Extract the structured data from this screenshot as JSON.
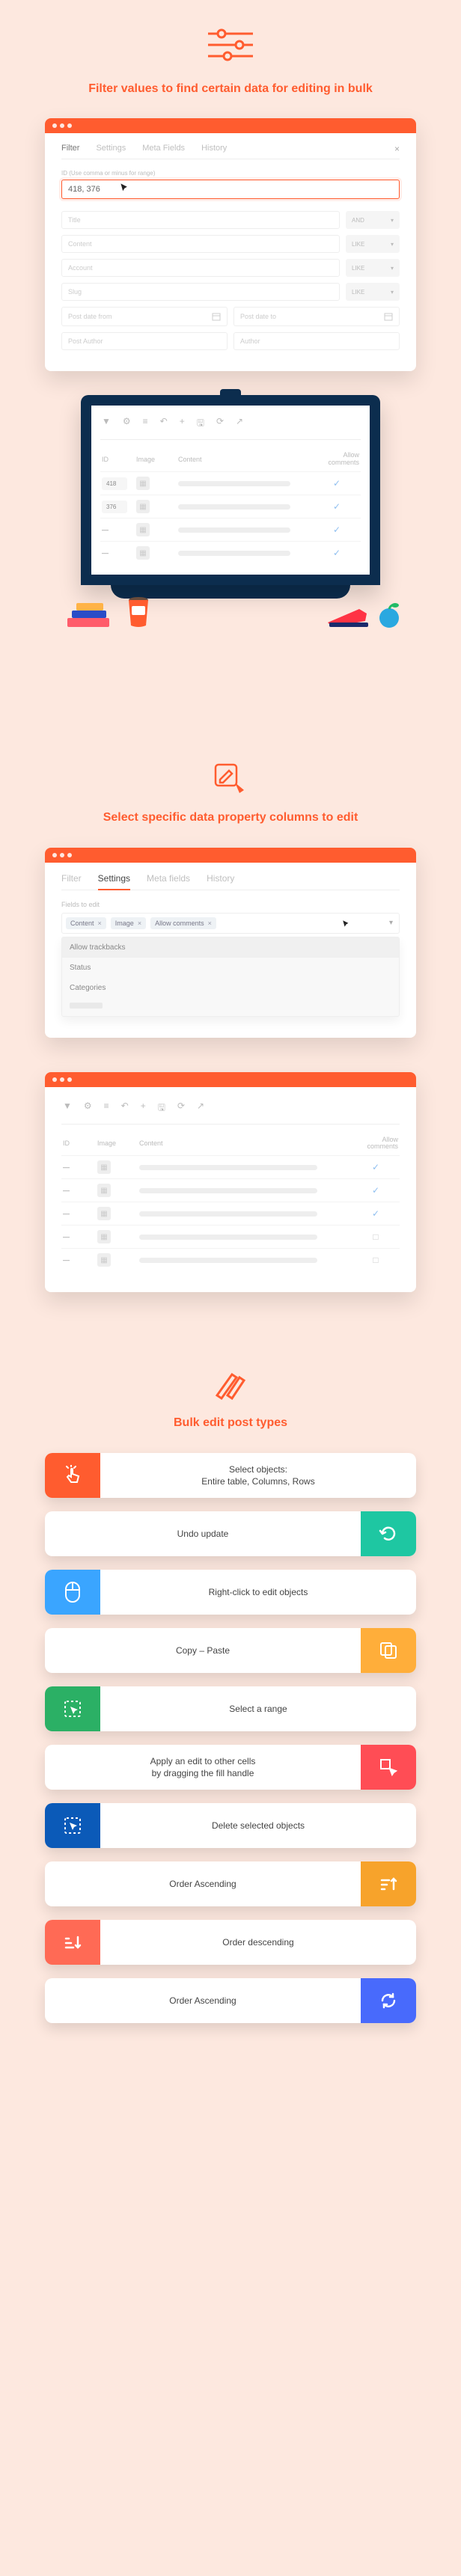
{
  "section1": {
    "title": "Filter values to find certain data for editing in bulk",
    "tabs": {
      "filter": "Filter",
      "settings": "Settings",
      "meta": "Meta Fields",
      "history": "History"
    },
    "id_hint": "ID (Use comma or minus for range)",
    "id_value": "418, 376",
    "filter_rows": {
      "title": "Title",
      "content": "Content",
      "account": "Account",
      "slug": "Slug",
      "date_from": "Post date from",
      "date_to": "Post date to",
      "author": "Post Author",
      "author_ph": "Author"
    },
    "select_and": "AND",
    "select_like": "LIKE"
  },
  "monitor": {
    "toolbar_icons": [
      "filter",
      "gear",
      "list",
      "undo",
      "plus",
      "save",
      "refresh",
      "open"
    ],
    "headers": {
      "id": "ID",
      "image": "Image",
      "content": "Content",
      "allow": "Allow comments"
    },
    "rows": [
      {
        "id": "418",
        "checked": true
      },
      {
        "id": "376",
        "checked": true
      },
      {
        "id": "",
        "checked": true
      },
      {
        "id": "",
        "checked": true
      }
    ]
  },
  "section2": {
    "title": "Select specific data property columns to edit",
    "tabs": {
      "filter": "Filter",
      "settings": "Settings",
      "meta": "Meta fields",
      "history": "History"
    },
    "fields_label": "Fields to edit",
    "chips": [
      "Content",
      "Image",
      "Allow comments"
    ],
    "dropdown": [
      "Allow trackbacks",
      "Status",
      "Categories"
    ]
  },
  "section3": {
    "title": "Bulk edit post types",
    "features": [
      {
        "side": "left",
        "color": "clr-orange",
        "icon": "tap",
        "line1": "Select objects:",
        "line2": "Entire table, Columns, Rows"
      },
      {
        "side": "right",
        "color": "clr-teal",
        "icon": "undo",
        "line1": "Undo update"
      },
      {
        "side": "left",
        "color": "clr-blue",
        "icon": "mouse",
        "line1": "Right-click to edit objects"
      },
      {
        "side": "right",
        "color": "clr-amber",
        "icon": "copy",
        "line1": "Copy – Paste"
      },
      {
        "side": "left",
        "color": "clr-green",
        "icon": "select",
        "line1": "Select a range"
      },
      {
        "side": "right",
        "color": "clr-red",
        "icon": "drag",
        "line1": "Apply an edit to other cells",
        "line2": "by dragging the fill handle"
      },
      {
        "side": "left",
        "color": "clr-navy",
        "icon": "delete",
        "line1": "Delete selected objects"
      },
      {
        "side": "right",
        "color": "clr-gold",
        "icon": "sort-asc",
        "line1": "Order Ascending"
      },
      {
        "side": "left",
        "color": "clr-coral",
        "icon": "sort-desc",
        "line1": "Order descending"
      },
      {
        "side": "right",
        "color": "clr-royal",
        "icon": "refresh",
        "line1": "Order Ascending"
      }
    ]
  }
}
